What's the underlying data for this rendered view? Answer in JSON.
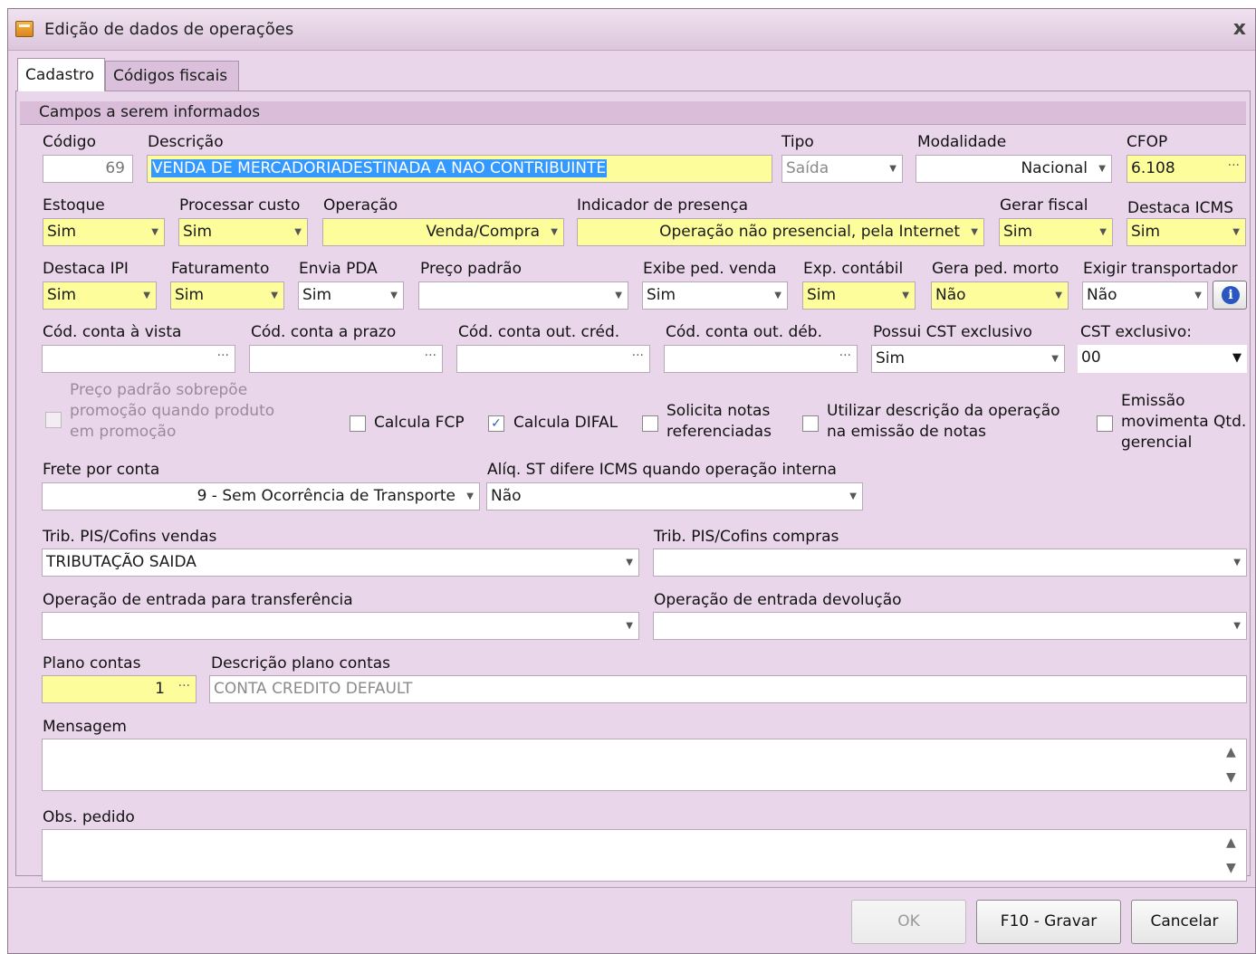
{
  "window": {
    "title": "Edição de dados de operações",
    "close_glyph": "x"
  },
  "tabs": [
    {
      "label": "Cadastro",
      "active": true
    },
    {
      "label": "Códigos fiscais",
      "active": false
    }
  ],
  "group_header": "Campos a serem informados",
  "row1": {
    "codigo": {
      "label": "Código",
      "value": "69"
    },
    "descricao": {
      "label": "Descrição",
      "value": "VENDA DE MERCADORIADESTINADA A NAO CONTRIBUINTE"
    },
    "tipo": {
      "label": "Tipo",
      "value": "Saída"
    },
    "modalidade": {
      "label": "Modalidade",
      "value": "Nacional"
    },
    "cfop": {
      "label": "CFOP",
      "value": "6.108"
    }
  },
  "row2": {
    "estoque": {
      "label": "Estoque",
      "value": "Sim"
    },
    "processar_custo": {
      "label": "Processar custo",
      "value": "Sim"
    },
    "operacao": {
      "label": "Operação",
      "value": "Venda/Compra"
    },
    "indicador_presenca": {
      "label": "Indicador de presença",
      "value": "Operação não presencial, pela Internet"
    },
    "gerar_fiscal": {
      "label": "Gerar fiscal",
      "value": "Sim"
    },
    "destaca_icms": {
      "label": "Destaca ICMS",
      "value": "Sim"
    }
  },
  "row3": {
    "destaca_ipi": {
      "label": "Destaca IPI",
      "value": "Sim"
    },
    "faturamento": {
      "label": "Faturamento",
      "value": "Sim"
    },
    "envia_pda": {
      "label": "Envia PDA",
      "value": "Sim"
    },
    "preco_padrao": {
      "label": "Preço padrão",
      "value": ""
    },
    "exibe_ped_venda": {
      "label": "Exibe ped. venda",
      "value": "Sim"
    },
    "exp_contabil": {
      "label": "Exp. contábil",
      "value": "Sim"
    },
    "gera_ped_morto": {
      "label": "Gera ped. morto",
      "value": "Não"
    },
    "exigir_transportador": {
      "label": "Exigir transportador",
      "value": "Não"
    }
  },
  "row4": {
    "cod_conta_vista": {
      "label": "Cód. conta à vista"
    },
    "cod_conta_prazo": {
      "label": "Cód. conta a prazo"
    },
    "cod_conta_out_cred": {
      "label": "Cód. conta out. créd."
    },
    "cod_conta_out_deb": {
      "label": "Cód. conta out. déb."
    },
    "possui_cst": {
      "label": "Possui CST exclusivo",
      "value": "Sim"
    },
    "cst_exclusivo": {
      "label": "CST exclusivo:",
      "value": "00"
    }
  },
  "checkboxes": {
    "preco_sobrepoe": {
      "line1": "Preço padrão sobrepõe",
      "line2": "promoção quando produto",
      "line3": "em promoção",
      "checked": false
    },
    "calcula_fcp": {
      "label": "Calcula FCP",
      "checked": false
    },
    "calcula_difal": {
      "label": "Calcula DIFAL",
      "checked": true
    },
    "solicita_notas": {
      "line1": "Solicita notas",
      "line2": "referenciadas",
      "checked": false
    },
    "utilizar_descricao": {
      "line1": "Utilizar descrição da operação",
      "line2": "na emissão de notas",
      "checked": false
    },
    "emissao_movimenta": {
      "line1": "Emissão",
      "line2": "movimenta Qtd.",
      "line3": "gerencial",
      "checked": false
    }
  },
  "row6": {
    "frete": {
      "label": "Frete por conta",
      "value": "9 - Sem Ocorrência de Transporte"
    },
    "aliq_st": {
      "label": "Alíq. ST difere ICMS quando operação interna",
      "value": "Não"
    }
  },
  "row7": {
    "pis_vendas": {
      "label": "Trib. PIS/Cofins vendas",
      "value": "TRIBUTAÇÃO SAIDA"
    },
    "pis_compras": {
      "label": "Trib. PIS/Cofins compras",
      "value": ""
    }
  },
  "row8": {
    "entrada_transf": {
      "label": "Operação de entrada para transferência",
      "value": ""
    },
    "entrada_devol": {
      "label": "Operação de entrada devolução",
      "value": ""
    }
  },
  "row9": {
    "plano_contas": {
      "label": "Plano contas",
      "value": "1"
    },
    "descricao_plano": {
      "label": "Descrição plano contas",
      "value": "CONTA CREDITO DEFAULT"
    }
  },
  "mensagem": {
    "label": "Mensagem",
    "value": ""
  },
  "obs_pedido": {
    "label": "Obs. pedido",
    "value": ""
  },
  "buttons": {
    "ok": "OK",
    "gravar": "F10 - Gravar",
    "cancelar": "Cancelar"
  },
  "glyphs": {
    "dropdown": "▼",
    "ellipsis": "···",
    "check": "✓",
    "info": "i",
    "up": "▲",
    "down": "▼"
  }
}
